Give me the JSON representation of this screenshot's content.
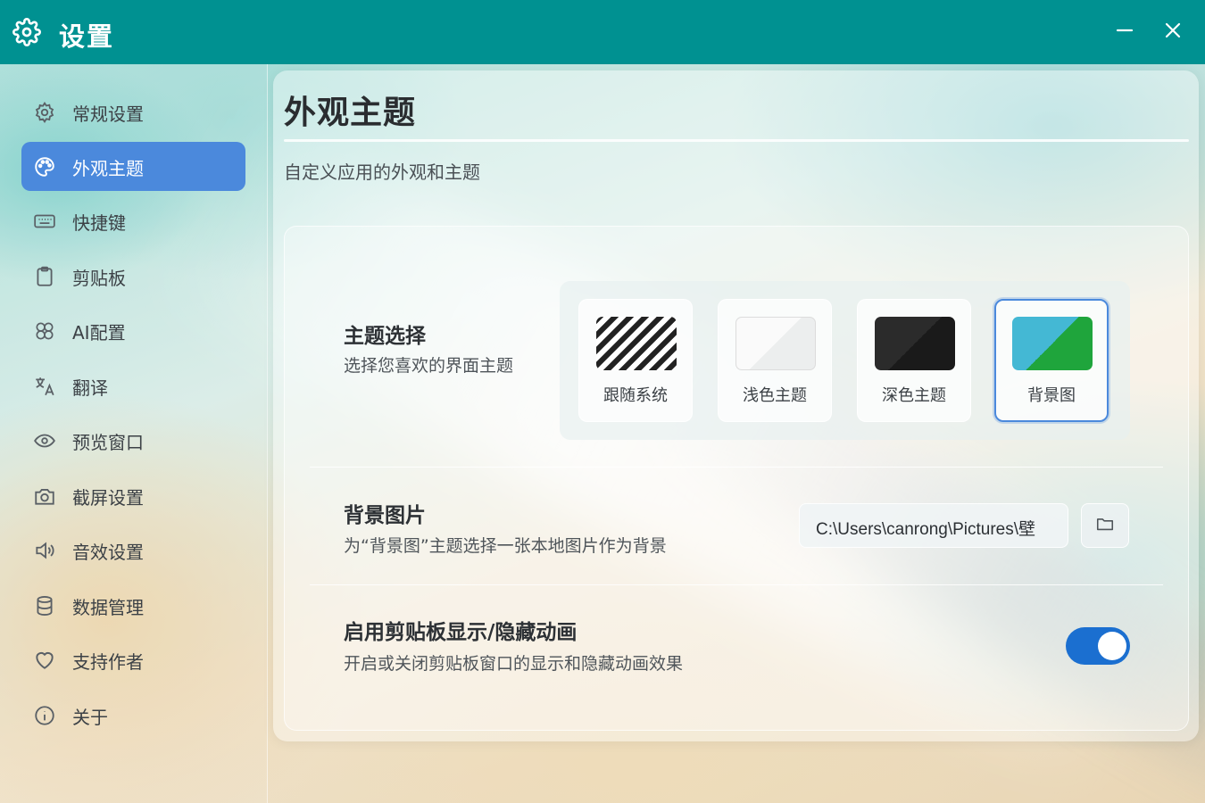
{
  "window": {
    "title": "设置",
    "accent_color": "#009191",
    "icons": {
      "app": "gear-icon",
      "minimize": "minimize-icon",
      "close": "close-icon"
    }
  },
  "sidebar": {
    "active_color": "#4b89dc",
    "items": [
      {
        "label": "常规设置",
        "icon": "gear-icon",
        "active": false
      },
      {
        "label": "外观主题",
        "icon": "palette-icon",
        "active": true
      },
      {
        "label": "快捷键",
        "icon": "keyboard-icon",
        "active": false
      },
      {
        "label": "剪贴板",
        "icon": "clipboard-icon",
        "active": false
      },
      {
        "label": "AI配置",
        "icon": "ai-icon",
        "active": false
      },
      {
        "label": "翻译",
        "icon": "translate-icon",
        "active": false
      },
      {
        "label": "预览窗口",
        "icon": "eye-icon",
        "active": false
      },
      {
        "label": "截屏设置",
        "icon": "camera-icon",
        "active": false
      },
      {
        "label": "音效设置",
        "icon": "speaker-icon",
        "active": false
      },
      {
        "label": "数据管理",
        "icon": "database-icon",
        "active": false
      },
      {
        "label": "支持作者",
        "icon": "heart-icon",
        "active": false
      },
      {
        "label": "关于",
        "icon": "info-icon",
        "active": false
      }
    ]
  },
  "main": {
    "title": "外观主题",
    "subtitle": "自定义应用的外观和主题",
    "theme_setting": {
      "title": "主题选择",
      "description": "选择您喜欢的界面主题",
      "options": [
        {
          "label": "跟随系统",
          "swatch": "system",
          "selected": false
        },
        {
          "label": "浅色主题",
          "swatch": "light",
          "selected": false
        },
        {
          "label": "深色主题",
          "swatch": "dark",
          "selected": false
        },
        {
          "label": "背景图",
          "swatch": "image",
          "selected": true
        }
      ]
    },
    "background_image": {
      "title": "背景图片",
      "description": "为“背景图”主题选择一张本地图片作为背景",
      "path_value": "C:\\Users\\canrong\\Pictures\\壁",
      "browse_icon": "folder-icon"
    },
    "animation_setting": {
      "title": "启用剪贴板显示/隐藏动画",
      "description": "开启或关闭剪贴板窗口的显示和隐藏动画效果",
      "enabled": true,
      "toggle_color": "#1b6fd0"
    }
  }
}
